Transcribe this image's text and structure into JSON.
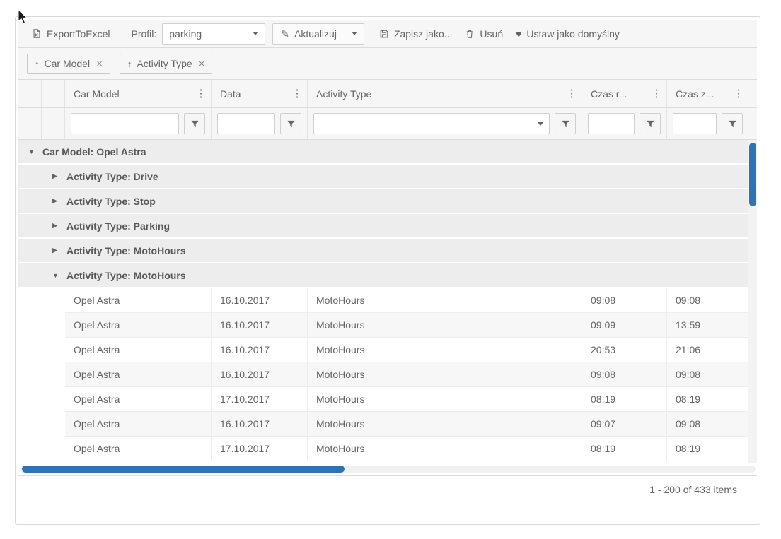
{
  "icons": {
    "sort_asc": "↑",
    "close": "×",
    "column_menu": "⋮",
    "pencil": "✎",
    "heart": "♥",
    "expand": "▶",
    "collapse": "▼"
  },
  "toolbar": {
    "export_label": "ExportToExcel",
    "profil_label": "Profil:",
    "profil_value": "parking",
    "aktualizuj_label": "Aktualizuj",
    "zapisz_label": "Zapisz jako...",
    "usun_label": "Usuń",
    "ustaw_label": "Ustaw jako domyślny"
  },
  "group_panel": {
    "chips": [
      {
        "label": "Car Model"
      },
      {
        "label": "Activity Type"
      }
    ]
  },
  "grid": {
    "columns": [
      {
        "title": "Car Model"
      },
      {
        "title": "Data"
      },
      {
        "title": "Activity Type"
      },
      {
        "title": "Czas r..."
      },
      {
        "title": "Czas z..."
      }
    ],
    "group_rows": {
      "level1": "Car Model: Opel Astra",
      "level2": [
        "Activity Type: Drive",
        "Activity Type: Stop",
        "Activity Type: Parking",
        "Activity Type: MotoHours",
        "Activity Type: MotoHours"
      ]
    },
    "rows": [
      [
        "Opel Astra",
        "16.10.2017",
        "MotoHours",
        "09:08",
        "09:08"
      ],
      [
        "Opel Astra",
        "16.10.2017",
        "MotoHours",
        "09:09",
        "13:59"
      ],
      [
        "Opel Astra",
        "16.10.2017",
        "MotoHours",
        "20:53",
        "21:06"
      ],
      [
        "Opel Astra",
        "16.10.2017",
        "MotoHours",
        "09:08",
        "09:08"
      ],
      [
        "Opel Astra",
        "17.10.2017",
        "MotoHours",
        "08:19",
        "08:19"
      ],
      [
        "Opel Astra",
        "16.10.2017",
        "MotoHours",
        "09:07",
        "09:08"
      ],
      [
        "Opel Astra",
        "17.10.2017",
        "MotoHours",
        "08:19",
        "08:19"
      ]
    ]
  },
  "pager": {
    "info": "1 - 200 of 433 items"
  },
  "colors": {
    "accent_scrollbar": "#2d73b5",
    "chrome_bg": "#f6f6f6",
    "group_row_bg": "#ededed",
    "text": "#656565",
    "border": "#dcdcdc"
  }
}
